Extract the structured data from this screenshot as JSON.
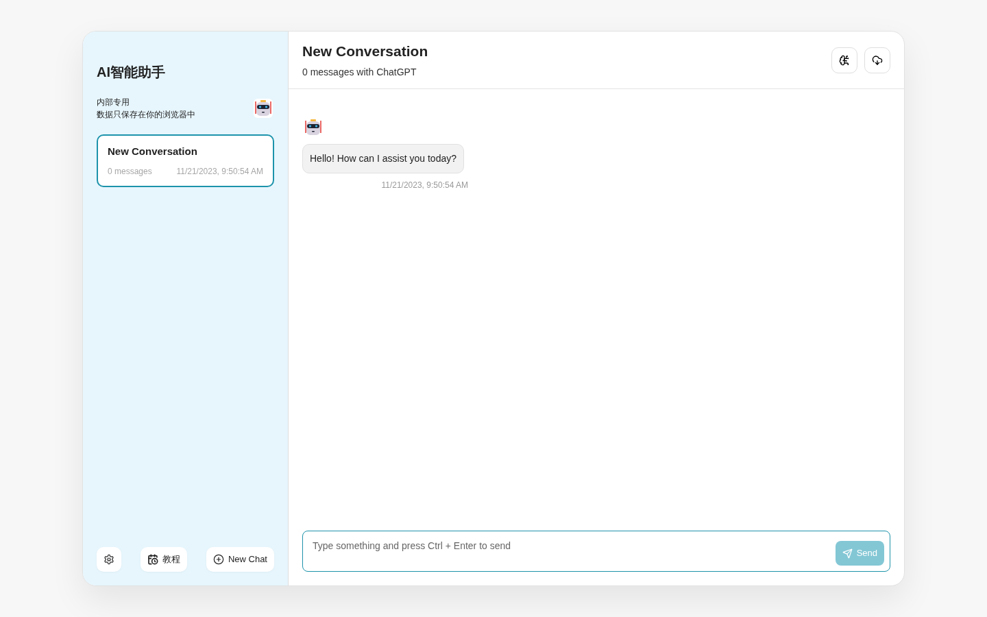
{
  "sidebar": {
    "title": "AI智能助手",
    "subtitle_lines": [
      "内部专用",
      "数据只保存在你的浏览器中"
    ],
    "chats": [
      {
        "title": "New Conversation",
        "count": "0 messages",
        "time": "11/21/2023, 9:50:54 AM",
        "selected": true
      }
    ],
    "buttons": [
      {
        "kind": "settings"
      },
      {
        "kind": "calendar",
        "label": "教程"
      },
      {
        "kind": "new",
        "label": "New Chat"
      }
    ]
  },
  "header": {
    "title": "New Conversation",
    "subtitle": "0 messages with ChatGPT"
  },
  "messages": [
    {
      "text": "Hello! How can I assist you today?",
      "time": "11/21/2023, 9:50:54 AM"
    }
  ],
  "composer": {
    "placeholder": "Type something and press Ctrl + Enter to send",
    "send": {
      "label": "Send",
      "disabled": true
    }
  }
}
